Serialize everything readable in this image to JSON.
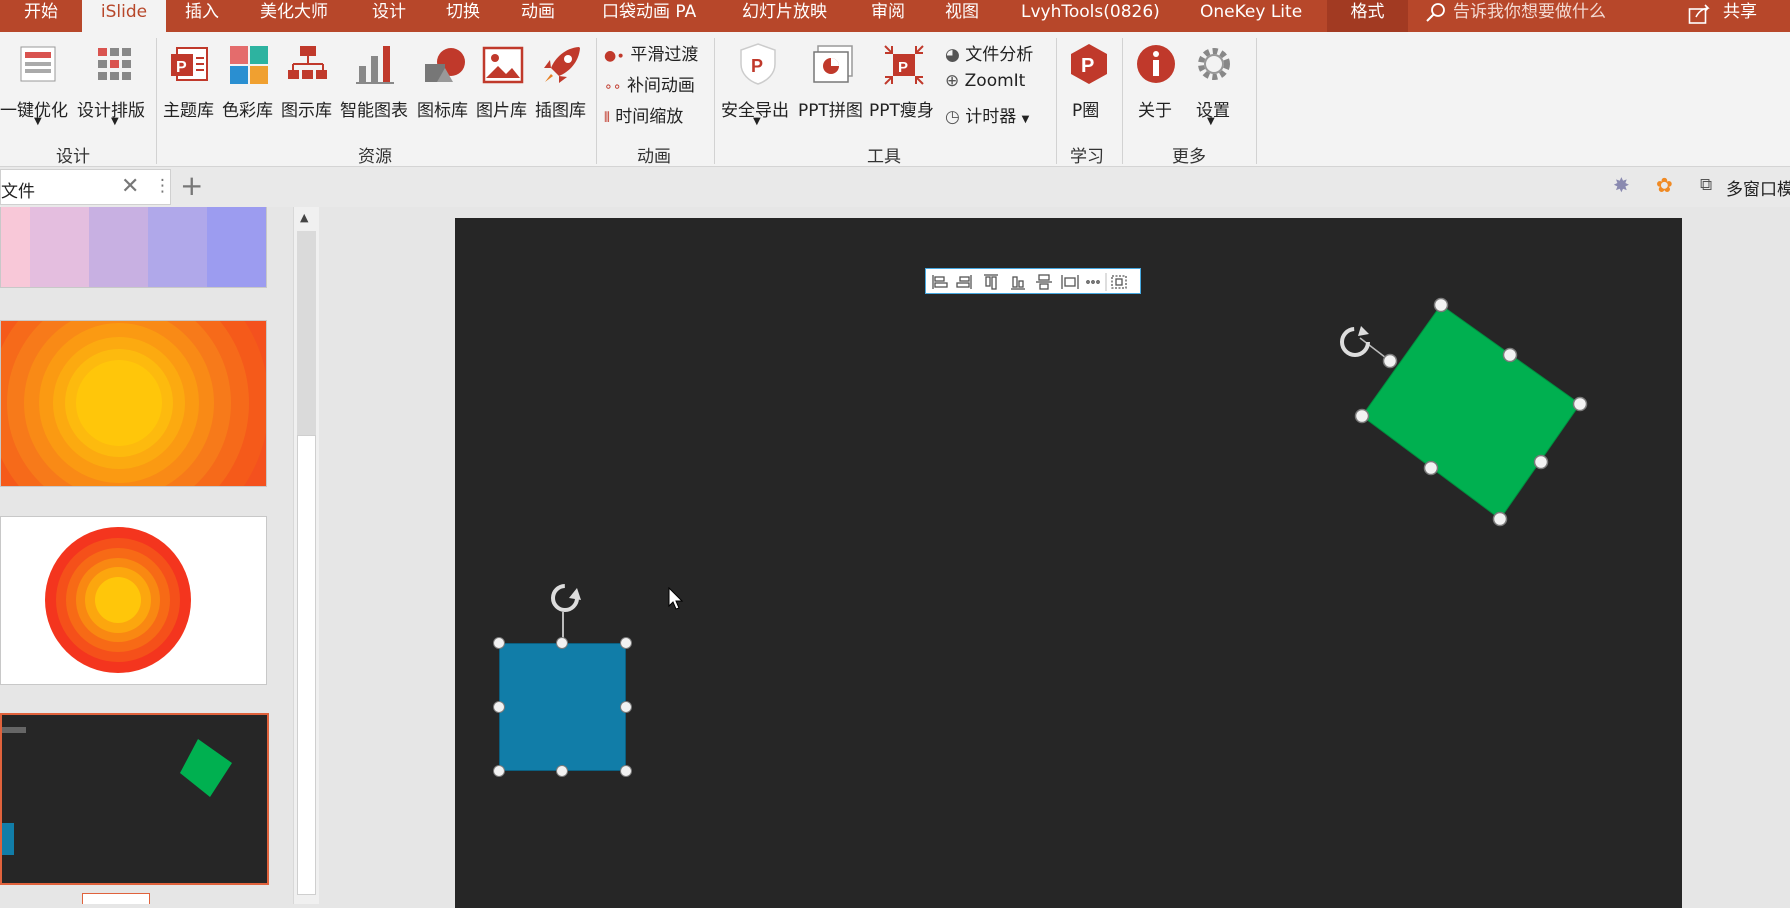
{
  "tabs": [
    "开始",
    "iSlide",
    "插入",
    "美化大师",
    "设计",
    "切换",
    "动画",
    "口袋动画 PA",
    "幻灯片放映",
    "审阅",
    "视图",
    "LvyhTools(0826)",
    "OneKey Lite",
    "格式"
  ],
  "tell_me": "告诉我你想要做什么",
  "share": "共享",
  "ribbon": {
    "design": {
      "optimize": "一键优化",
      "layout": "设计排版",
      "group": "设计"
    },
    "resources": {
      "theme": "主题库",
      "color": "色彩库",
      "diagram": "图示库",
      "chart": "智能图表",
      "icon": "图标库",
      "picture": "图片库",
      "illustration": "插图库",
      "group": "资源"
    },
    "animation": {
      "smooth": "平滑过渡",
      "tween": "补间动画",
      "timescale": "时间缩放",
      "group": "动画"
    },
    "tools": {
      "export": "安全导出",
      "collage": "PPT拼图",
      "slim": "PPT瘦身",
      "analysis": "文件分析",
      "zoomit": "ZoomIt",
      "timer": "计时器",
      "group": "工具"
    },
    "learn": {
      "pquan": "P圈",
      "group": "学习"
    },
    "more": {
      "about": "关于",
      "settings": "设置",
      "group": "更多"
    }
  },
  "doc_tab": "文件",
  "multiwindow": "多窗口模",
  "colors": {
    "accent": "#b7472a",
    "green": "#00b050",
    "blue": "#117da8",
    "slide_bg": "#262626"
  },
  "align_toolbar": [
    "align-left-icon",
    "align-center-icon",
    "align-top-icon",
    "align-bottom-icon",
    "align-middle-icon",
    "distribute-icon",
    "more-icon",
    "group-icon"
  ]
}
